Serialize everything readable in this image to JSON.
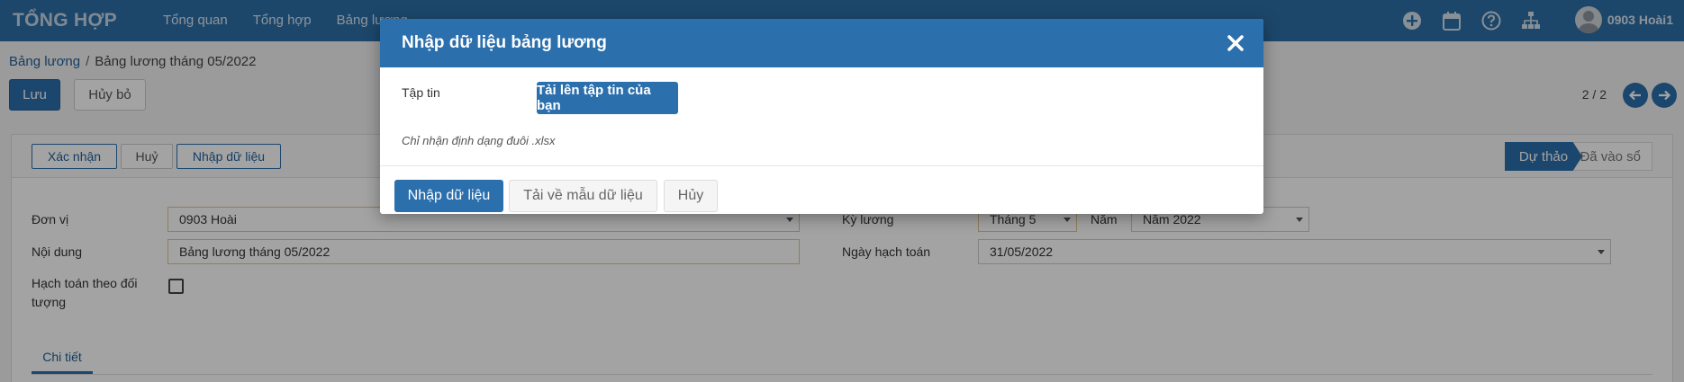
{
  "navbar": {
    "brand": "TỔNG HỢP",
    "menu": [
      "Tổng quan",
      "Tổng hợp",
      "Bảng lương"
    ],
    "icons": [
      "plus-circle-icon",
      "calendar-icon",
      "help-icon",
      "sitemap-icon"
    ],
    "user": "0903 Hoài1"
  },
  "breadcrumb": {
    "parent": "Bảng lương",
    "separator": "/",
    "current": "Bảng lương tháng 05/2022"
  },
  "actions": {
    "save": "Lưu",
    "discard": "Hủy bỏ"
  },
  "pager": {
    "value": "2 / 2"
  },
  "statusbar": {
    "confirm": "Xác nhận",
    "cancel": "Huỷ",
    "import": "Nhập dữ liệu",
    "states": {
      "draft": "Dự thảo",
      "posted": "Đã vào sổ"
    }
  },
  "form": {
    "unit_label": "Đơn vị",
    "unit_value": "0903 Hoài",
    "content_label": "Nội dung",
    "content_value": "Bảng lương tháng 05/2022",
    "by_object_label": "Hạch toán theo đối tượng",
    "period_label": "Kỳ lương",
    "period_month": "Tháng 5",
    "year_label": "Năm",
    "year_value": "Năm 2022",
    "accounting_date_label": "Ngày hạch toán",
    "accounting_date_value": "31/05/2022"
  },
  "tabs": {
    "detail": "Chi tiết"
  },
  "modal": {
    "title": "Nhập dữ liệu bảng lương",
    "file_label": "Tập tin",
    "upload": "Tải lên tập tin của bạn",
    "hint": "Chỉ nhận định dạng đuôi .xlsx",
    "import": "Nhập dữ liệu",
    "download_template": "Tải về mẫu dữ liệu",
    "cancel": "Hủy"
  },
  "colors": {
    "primary": "#2b6fad",
    "navbar": "#2d6fa8",
    "required_border": "#e0c58a"
  }
}
